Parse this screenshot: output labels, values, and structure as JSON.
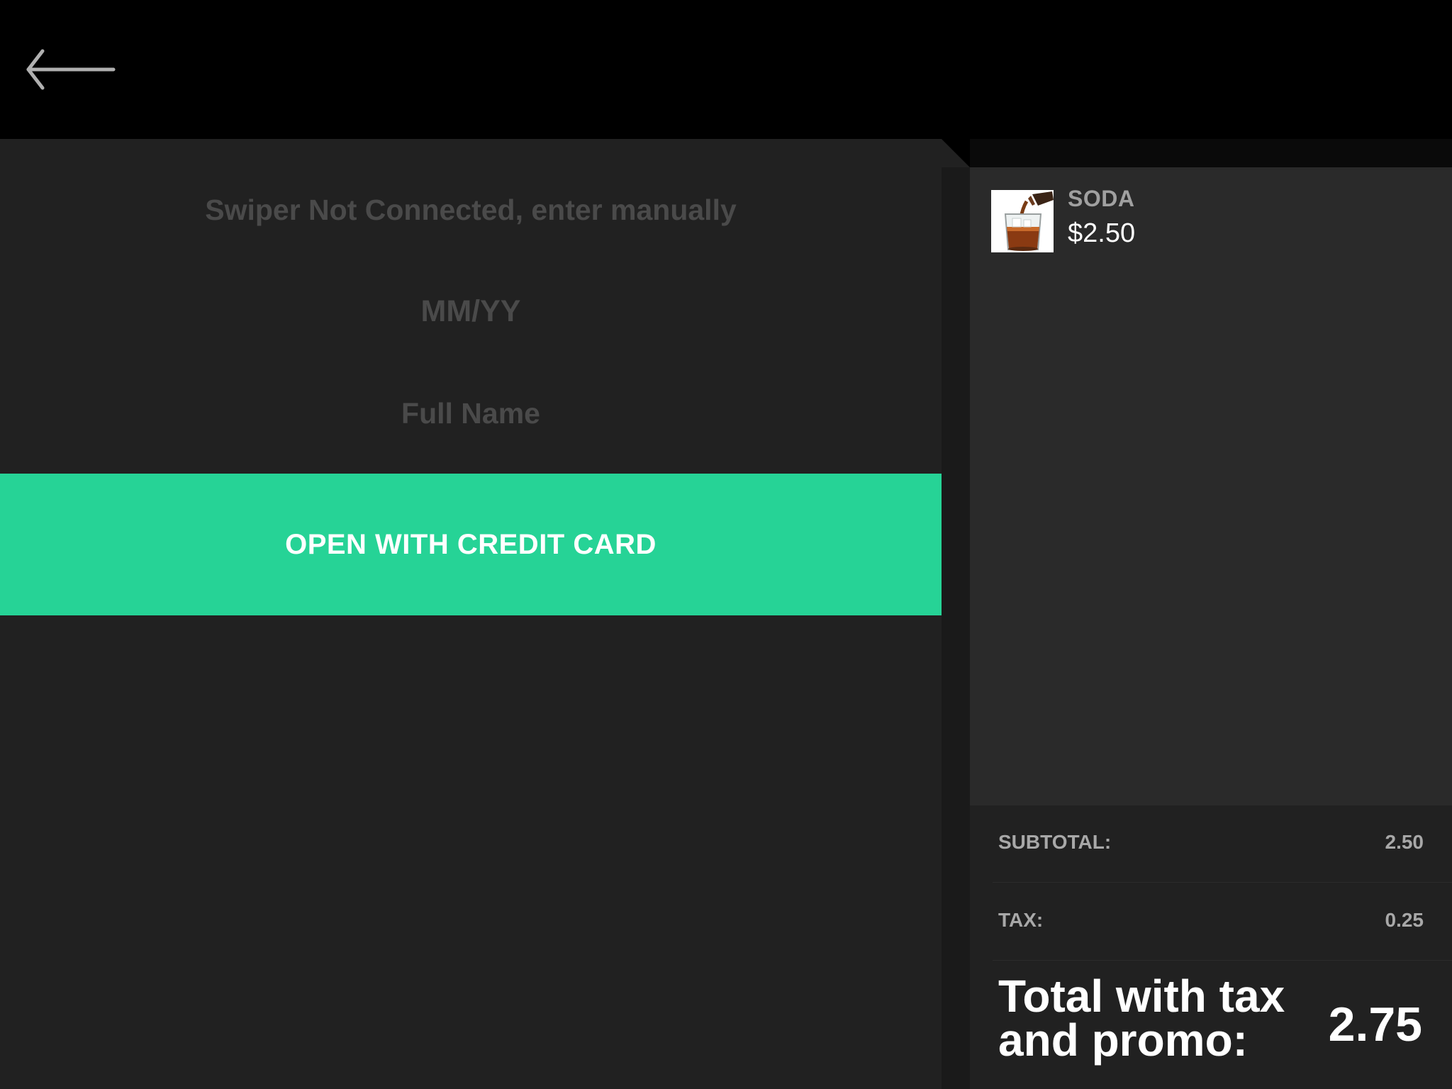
{
  "header": {
    "back_icon": "arrow-left-icon"
  },
  "payment_form": {
    "card_placeholder": "Swiper Not Connected, enter manually",
    "expiry_placeholder": "MM/YY",
    "name_placeholder": "Full Name",
    "submit_label": "OPEN WITH CREDIT CARD"
  },
  "order": {
    "items": [
      {
        "name": "SODA",
        "price": "$2.50",
        "thumbnail_icon": "soda-glass-icon"
      }
    ]
  },
  "summary": {
    "subtotal_label": "SUBTOTAL:",
    "subtotal_value": "2.50",
    "tax_label": "TAX:",
    "tax_value": "0.25",
    "total_label": "Total with tax and promo:",
    "total_value": "2.75"
  },
  "colors": {
    "accent": "#26d396",
    "background": "#000000",
    "panel": "#212121",
    "list_panel": "#2a2a2a",
    "placeholder_text": "#4a4a4a"
  }
}
